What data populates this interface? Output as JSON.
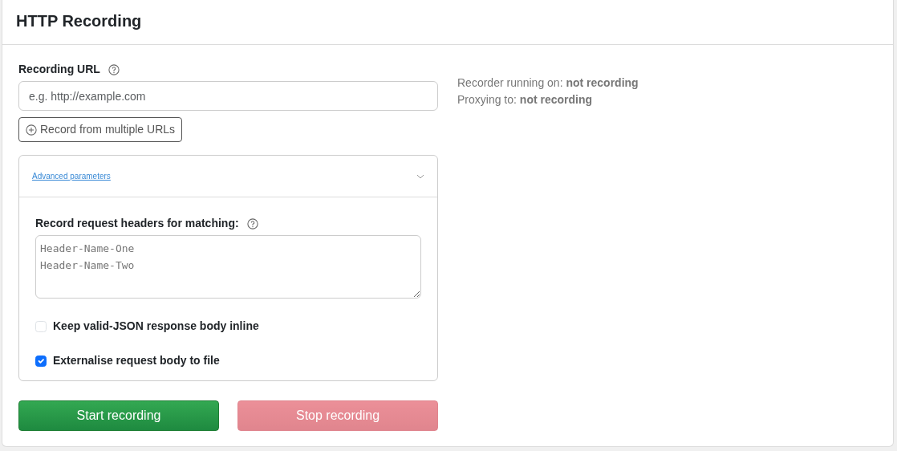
{
  "card": {
    "title": "HTTP Recording"
  },
  "url_field": {
    "label": "Recording URL",
    "placeholder": "e.g. http://example.com"
  },
  "multi_url_button": {
    "label": "Record from multiple URLs"
  },
  "advanced": {
    "title": "Advanced parameters",
    "expanded": true,
    "headers_label": "Record request headers for matching:",
    "headers_placeholder": "Header-Name-One\nHeader-Name-Two",
    "options": [
      {
        "label": "Keep valid-JSON response body inline",
        "checked": false
      },
      {
        "label": "Externalise request body to file",
        "checked": true
      }
    ]
  },
  "buttons": [
    {
      "label": "Start recording",
      "kind": "start",
      "disabled": false
    },
    {
      "label": "Stop recording",
      "kind": "stop",
      "disabled": true
    }
  ],
  "status": [
    "Recorder running on: **not recording**",
    "Proxying to: **not recording**"
  ]
}
